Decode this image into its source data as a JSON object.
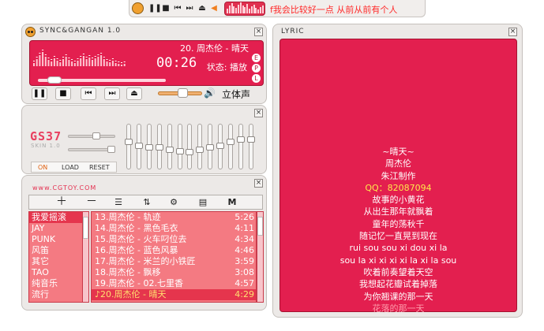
{
  "mini_bar": {
    "lyric_text": "f我会比较好一点   从前从前有个人",
    "buttons": [
      "pause",
      "stop",
      "prev",
      "next",
      "eject",
      "volume"
    ]
  },
  "player": {
    "title": "SYNC&GANGAN 1.0",
    "now_playing": "20. 周杰伦 - 晴天",
    "time": "00:26",
    "status": "状态: 播放",
    "side_tags": [
      "E",
      "P",
      "L"
    ],
    "stereo_label": "立体声",
    "progress": 0.1,
    "volume": 0.45,
    "controls": [
      "pause",
      "stop",
      "previous",
      "next",
      "eject"
    ]
  },
  "equalizer": {
    "logo": "GS37",
    "skin_label": "SKIN 1.0",
    "buttons": {
      "on": "ON",
      "load": "LOAD",
      "reset": "RESET"
    },
    "preamp": 0.55,
    "balance": 0.9,
    "bands": [
      0.35,
      0.45,
      0.5,
      0.5,
      0.55,
      0.6,
      0.62,
      0.55,
      0.5,
      0.45,
      0.35,
      0.3,
      0.3
    ]
  },
  "playlist": {
    "url": "www.CGTOY.COM",
    "toolbar": [
      "add",
      "remove",
      "list",
      "sort",
      "tools",
      "file",
      "menu"
    ],
    "categories": [
      {
        "label": "我爱摇滚",
        "selected": true
      },
      {
        "label": "JAY",
        "selected": false
      },
      {
        "label": "PUNK",
        "selected": false
      },
      {
        "label": "风笛",
        "selected": false
      },
      {
        "label": "其它",
        "selected": false
      },
      {
        "label": "TAO",
        "selected": false
      },
      {
        "label": "纯音乐",
        "selected": false
      },
      {
        "label": "流行",
        "selected": false
      }
    ],
    "songs": [
      {
        "title": "13.周杰伦 - 轨迹",
        "duration": "5:26",
        "selected": false
      },
      {
        "title": "14.周杰伦 - 黑色毛衣",
        "duration": "4:11",
        "selected": false
      },
      {
        "title": "15.周杰伦 - 火车叼位去",
        "duration": "4:34",
        "selected": false
      },
      {
        "title": "16.周杰伦 - 蓝色风暴",
        "duration": "4:46",
        "selected": false
      },
      {
        "title": "17.周杰伦 - 米兰的小铁匠",
        "duration": "3:59",
        "selected": false
      },
      {
        "title": "18.周杰伦 - 飘移",
        "duration": "3:08",
        "selected": false
      },
      {
        "title": "19.周杰伦 - 02.七里香",
        "duration": "4:57",
        "selected": false
      },
      {
        "title": "20.周杰伦 - 晴天",
        "duration": "4:29",
        "selected": true,
        "marker": "♪"
      }
    ]
  },
  "lyric": {
    "title": "LYRIC",
    "lines": [
      {
        "text": "~晴天~",
        "style": ""
      },
      {
        "text": "周杰伦",
        "style": ""
      },
      {
        "text": "朱江制作",
        "style": ""
      },
      {
        "text": "QQ：82087094",
        "style": "qq"
      },
      {
        "text": "故事的小黄花",
        "style": ""
      },
      {
        "text": "从出生那年就飘着",
        "style": ""
      },
      {
        "text": "童年的荡秋千",
        "style": ""
      },
      {
        "text": "随记忆一直晃到现在",
        "style": ""
      },
      {
        "text": "rui sou sou xi dou xi la",
        "style": ""
      },
      {
        "text": "sou la xi xi xi xi la xi la sou",
        "style": ""
      },
      {
        "text": "吹着前奏望着天空",
        "style": ""
      },
      {
        "text": "我想起花瓣试着掉落",
        "style": ""
      },
      {
        "text": "为你翘课的那一天",
        "style": ""
      },
      {
        "text": "花落的那一天",
        "style": "fade"
      }
    ]
  },
  "colors": {
    "display_red": "#e31f4f",
    "list_pink": "#f47a82",
    "accent_orange": "#f08020",
    "qq_yellow": "#ffe84a"
  }
}
